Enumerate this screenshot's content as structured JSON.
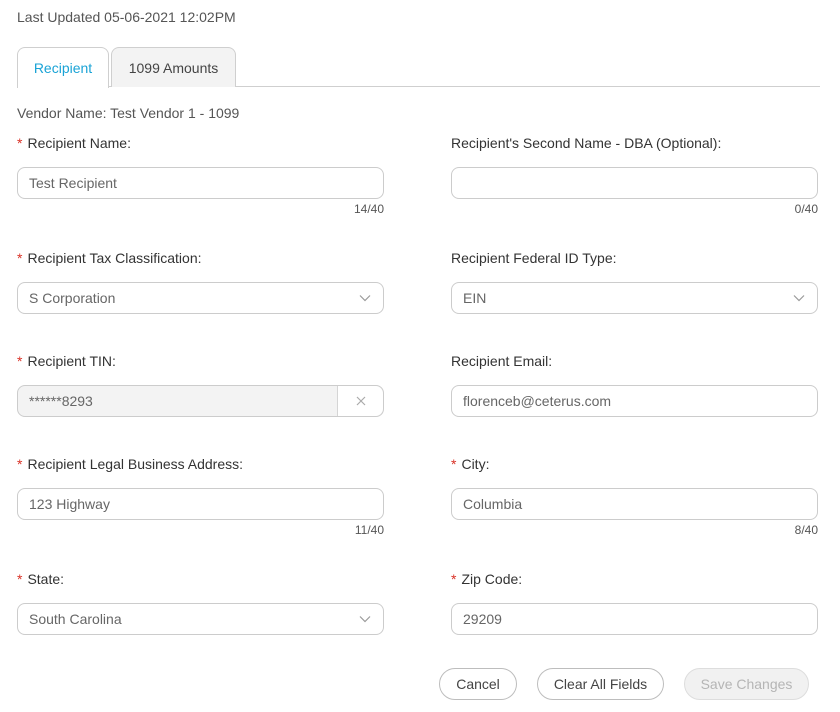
{
  "header": {
    "last_updated": "Last Updated 05-06-2021 12:02PM"
  },
  "tabs": [
    {
      "label": "Recipient",
      "active": true
    },
    {
      "label": "1099 Amounts",
      "active": false
    }
  ],
  "vendor_name": "Vendor Name: Test Vendor 1 - 1099",
  "form": {
    "recipient_name": {
      "label": "Recipient Name",
      "value": "Test Recipient",
      "counter": "14/40",
      "required": true
    },
    "second_name": {
      "label": "Recipient's Second Name - DBA (Optional)",
      "value": "",
      "counter": "0/40",
      "required": false
    },
    "tax_classification": {
      "label": "Recipient Tax Classification",
      "value": "S Corporation",
      "required": true
    },
    "federal_id_type": {
      "label": "Recipient Federal ID Type",
      "value": "EIN",
      "required": false
    },
    "tin": {
      "label": "Recipient TIN",
      "value": "******8293",
      "required": true
    },
    "email": {
      "label": "Recipient Email",
      "value": "florenceb@ceterus.com",
      "required": false
    },
    "address": {
      "label": "Recipient Legal Business Address",
      "value": "123 Highway",
      "counter": "11/40",
      "required": true
    },
    "city": {
      "label": "City",
      "value": "Columbia",
      "counter": "8/40",
      "required": true
    },
    "state": {
      "label": "State",
      "value": "South Carolina",
      "required": true
    },
    "zip": {
      "label": "Zip Code",
      "value": "29209",
      "required": true
    }
  },
  "colon": ":",
  "required_mark": "*",
  "actions": {
    "cancel": "Cancel",
    "clear_all": "Clear All Fields",
    "save": "Save Changes"
  },
  "icons": {
    "select_arrow": "chevron-down-icon",
    "clear": "close-icon"
  },
  "colors": {
    "accent": "#1aa3d6",
    "required": "#d93025"
  }
}
